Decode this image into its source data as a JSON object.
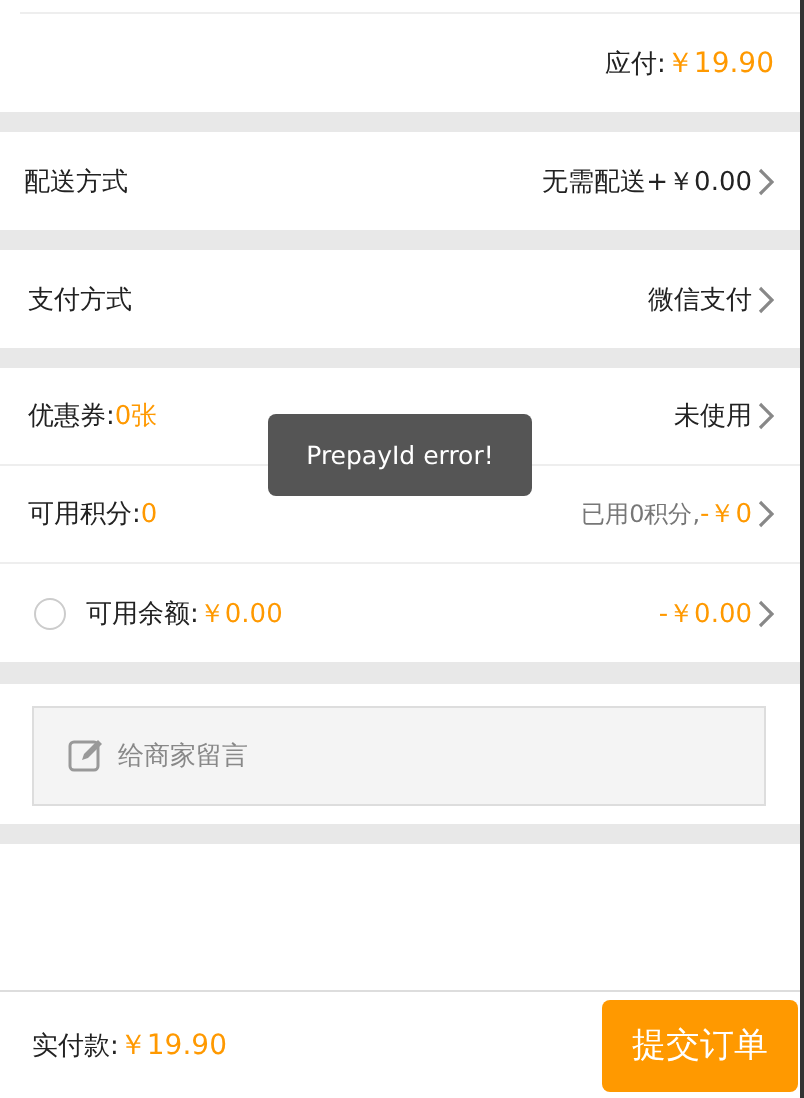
{
  "payable": {
    "label": "应付:",
    "amount": "￥19.90"
  },
  "delivery": {
    "label": "配送方式",
    "value": "无需配送+￥0.00"
  },
  "payment": {
    "label": "支付方式",
    "value": "微信支付"
  },
  "coupon": {
    "label": "优惠券:",
    "count": "0张",
    "value": "未使用"
  },
  "points": {
    "label": "可用积分:",
    "count": "0",
    "used": "已用0积分,",
    "deduct": "-￥0"
  },
  "balance": {
    "checked": false,
    "label": "可用余额:",
    "amount": "￥0.00",
    "deduct": "-￥0.00"
  },
  "message": {
    "placeholder": "给商家留言"
  },
  "toast": "PrepayId error!",
  "footer": {
    "label": "实付款:",
    "amount": "￥19.90",
    "submit": "提交订单"
  }
}
